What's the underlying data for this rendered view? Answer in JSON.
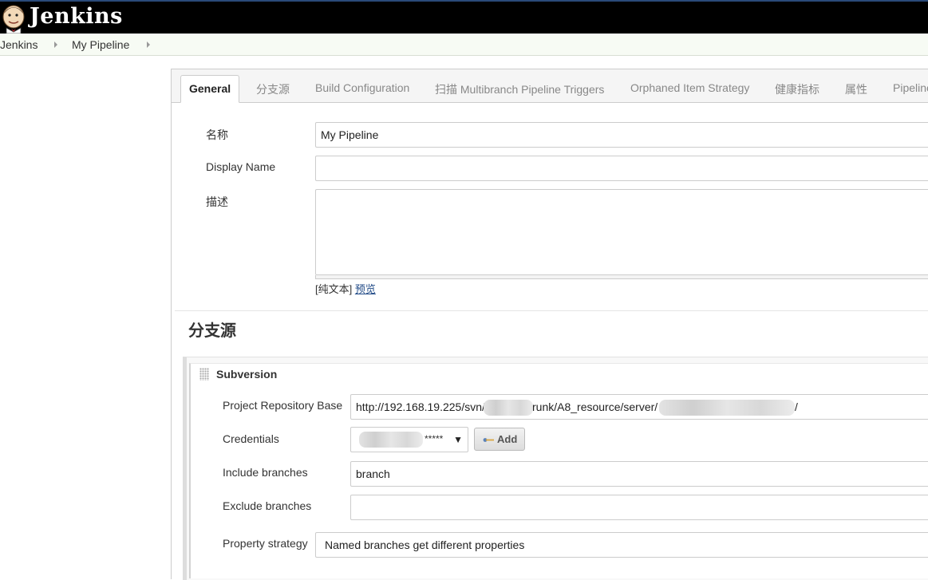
{
  "header": {
    "app_name": "Jenkins",
    "logo_icon": "jenkins-butler-icon"
  },
  "breadcrumb": {
    "items": [
      "Jenkins",
      "My Pipeline"
    ]
  },
  "tabs": [
    {
      "label": "General",
      "active": true
    },
    {
      "label": "分支源"
    },
    {
      "label": "Build Configuration"
    },
    {
      "label": "扫描 Multibranch Pipeline Triggers"
    },
    {
      "label": "Orphaned Item Strategy"
    },
    {
      "label": "健康指标"
    },
    {
      "label": "属性"
    },
    {
      "label": "Pipeline"
    }
  ],
  "general": {
    "name_label": "名称",
    "name_value": "My Pipeline",
    "display_name_label": "Display Name",
    "display_name_value": "",
    "description_label": "描述",
    "description_value": "",
    "format_prefix": "[纯文本]",
    "preview_link": "预览"
  },
  "branch_sources": {
    "section_title": "分支源",
    "scm_title": "Subversion",
    "repo_base_label": "Project Repository Base",
    "repo_base_part1": "http://192.168.19.225/svn/",
    "repo_base_part2": "runk/A8_resource/server/",
    "repo_base_part3": "/",
    "credentials_label": "Credentials",
    "credentials_masked": "*****",
    "add_button": "Add",
    "include_label": "Include branches",
    "include_value": "branch",
    "exclude_label": "Exclude branches",
    "exclude_value": "",
    "property_label": "Property strategy",
    "property_value": "Named branches get different properties"
  },
  "colors": {
    "header_bg": "#000000",
    "breadcrumb_bg": "#f7fbf4",
    "link": "#204a87"
  }
}
